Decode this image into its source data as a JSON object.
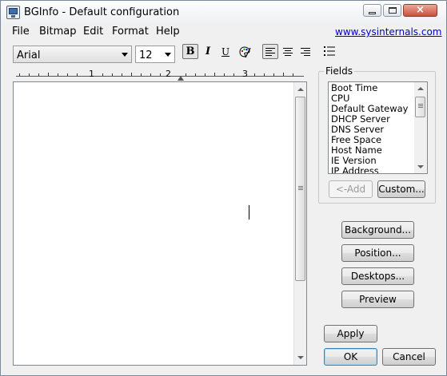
{
  "window": {
    "title": "BGInfo - Default configuration",
    "close_glyph": "×"
  },
  "menu": {
    "items": [
      "File",
      "Bitmap",
      "Edit",
      "Format",
      "Help"
    ],
    "link": "www.sysinternals.com"
  },
  "toolbar": {
    "font": "Arial",
    "font_size": "12",
    "bold": "B",
    "italic": "I",
    "underline": "U",
    "bold_pressed": true,
    "align_left_pressed": true,
    "icons": {
      "color": "color-palette-icon",
      "align_left": "align-left-icon",
      "align_center": "align-center-icon",
      "align_right": "align-right-icon",
      "bullets": "bullet-list-icon"
    }
  },
  "ruler": {
    "numbers": [
      "1",
      "2",
      "3"
    ]
  },
  "fields": {
    "label": "Fields",
    "items": [
      "Boot Time",
      "CPU",
      "Default Gateway",
      "DHCP Server",
      "DNS Server",
      "Free Space",
      "Host Name",
      "IE Version",
      "IP Address"
    ]
  },
  "buttons": {
    "add": "<-Add",
    "custom": "Custom...",
    "background": "Background...",
    "position": "Position...",
    "desktops": "Desktops...",
    "preview": "Preview",
    "apply": "Apply",
    "ok": "OK",
    "cancel": "Cancel"
  },
  "colors": {
    "link": "#0000cc",
    "close_button": "#c9503b",
    "default_button_border": "#3c7fb1"
  }
}
